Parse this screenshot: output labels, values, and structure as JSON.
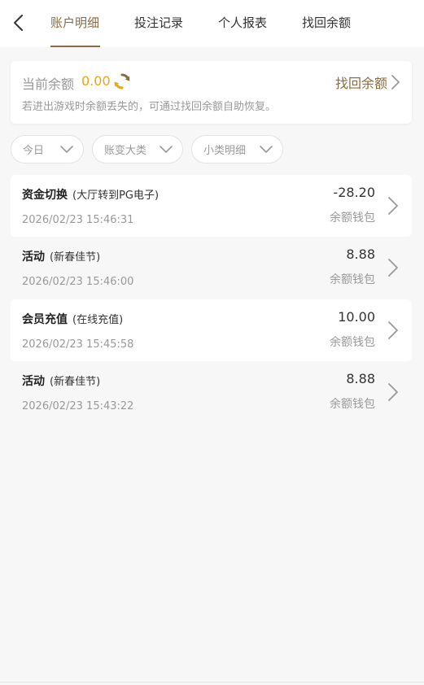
{
  "header": {
    "tabs": [
      {
        "label": "账户明细",
        "active": true
      },
      {
        "label": "投注记录",
        "active": false
      },
      {
        "label": "个人报表",
        "active": false
      },
      {
        "label": "找回余额",
        "active": false
      }
    ]
  },
  "balance": {
    "label": "当前余额",
    "value": "0.00",
    "recover_label": "找回余额",
    "hint": "若进出游戏时余额丢失的，可通过找回余额自助恢复。"
  },
  "filters": [
    {
      "label": "今日"
    },
    {
      "label": "账变大类"
    },
    {
      "label": "小类明细"
    }
  ],
  "records": [
    {
      "category": "资金切换",
      "detail": "(大厅转到PG电子)",
      "time": "2026/02/23 15:46:31",
      "amount": "-28.20",
      "wallet": "余额钱包"
    },
    {
      "category": "活动",
      "detail": "(新春佳节)",
      "time": "2026/02/23 15:46:00",
      "amount": "8.88",
      "wallet": "余额钱包"
    },
    {
      "category": "会员充值",
      "detail": "(在线充值)",
      "time": "2026/02/23 15:45:58",
      "amount": "10.00",
      "wallet": "余额钱包"
    },
    {
      "category": "活动",
      "detail": "(新春佳节)",
      "time": "2026/02/23 15:43:22",
      "amount": "8.88",
      "wallet": "余额钱包"
    }
  ],
  "colors": {
    "accent": "#8a6d3b",
    "balance_value": "#e6a817",
    "muted_text": "#999999",
    "background": "#f7f7f7"
  },
  "icons": {
    "back": "chevron-left-icon",
    "refresh": "refresh-icon",
    "recover_arrow": "chevron-right-icon",
    "filter_arrow": "chevron-down-icon",
    "record_arrow": "chevron-right-icon"
  }
}
